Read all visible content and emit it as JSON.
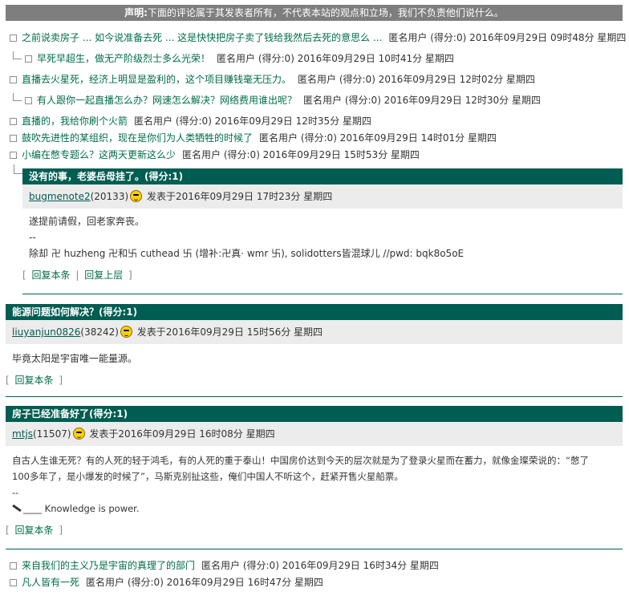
{
  "disclaimer": {
    "label": "声明:",
    "text": "下面的评论属于其发表者所有，不代表本站的观点和立场，我们不负责他们说什么。"
  },
  "threads": [
    {
      "title": "之前说卖房子 ... 如今说准备去死 ... 这是快快把房子卖了钱给我然后去死的意思么 ...",
      "meta": "匿名用户 (得分:0) 2016年09月29日 09时48分 星期四"
    },
    {
      "title": "早死早超生，做无产阶级烈士多么光荣！",
      "meta": "匿名用户 (得分:0) 2016年09月29日 10时41分 星期四"
    },
    {
      "title": "直播去火星死，经济上明显是盈利的，这个项目赚钱毫无压力。",
      "meta": "匿名用户 (得分:0) 2016年09月29日 12时02分 星期四"
    },
    {
      "title": "有人跟你一起直播怎么办？网速怎么解决？网络费用谁出呢？",
      "meta": "匿名用户 (得分:0) 2016年09月29日 12时30分 星期四"
    },
    {
      "title": "直播的，我给你刷个火箭",
      "meta": "匿名用户 (得分:0) 2016年09月29日 12时35分 星期四"
    },
    {
      "title": "鼓吹先进性的某组织，现在是你们为人类牺牲的时候了",
      "meta": "匿名用户 (得分:0) 2016年09月29日 14时01分 星期四"
    },
    {
      "title": "小编在憋专题么？这两天更新这么少",
      "meta": "匿名用户 (得分:0) 2016年09月29日 15时53分 星期四"
    }
  ],
  "panels": [
    {
      "title": "没有的事，老婆岳母挂了。(得分:1)",
      "author": "bugmenote2",
      "author_id": "(20133)",
      "posted": "发表于2016年09月29日 17时23分 星期四",
      "lines": [
        "遂提前请假，回老家奔丧。",
        "--",
        "除却 卍 huzheng 卍和卐 cuthead 卐 (增补:卍真· wmr 卐), solidotters皆混球儿 //pwd: bqk8o5oE"
      ],
      "links": [
        "回复本条",
        "回复上层"
      ]
    },
    {
      "title": "能源问题如何解决？(得分:1)",
      "author": "liuyanjun0826",
      "author_id": "(38242)",
      "posted": "发表于2016年09月29日 15时56分 星期四",
      "lines": [
        "毕竟太阳是宇宙唯一能量源。"
      ],
      "links": [
        "回复本条"
      ]
    },
    {
      "title": "房子已经准备好了(得分:1)",
      "author": "mtjs",
      "author_id": "(11507)",
      "posted": "发表于2016年09月29日 16时08分 星期四",
      "lines": [
        "自古人生谁无死？有的人死的轻于鸿毛，有的人死的重于泰山！中国房价达到今天的层次就是为了登录火星而在蓄力，就像金璨荣说的：“憋了",
        "100多年了，是小爆发的时候了”，马斯克别扯这些，俺们中国人不听这个，赶紧开售火星船票。",
        "--",
        "____ Knowledge is power."
      ],
      "links": [
        "回复本条"
      ]
    }
  ],
  "bottom_threads": [
    {
      "title": "来自我们的主义乃是宇宙的真理了的部门",
      "meta": "匿名用户 (得分:0) 2016年09月29日 16时34分 星期四"
    },
    {
      "title": "凡人皆有一死",
      "meta": "匿名用户 (得分:0) 2016年09月29日 16时47分 星期四"
    }
  ]
}
